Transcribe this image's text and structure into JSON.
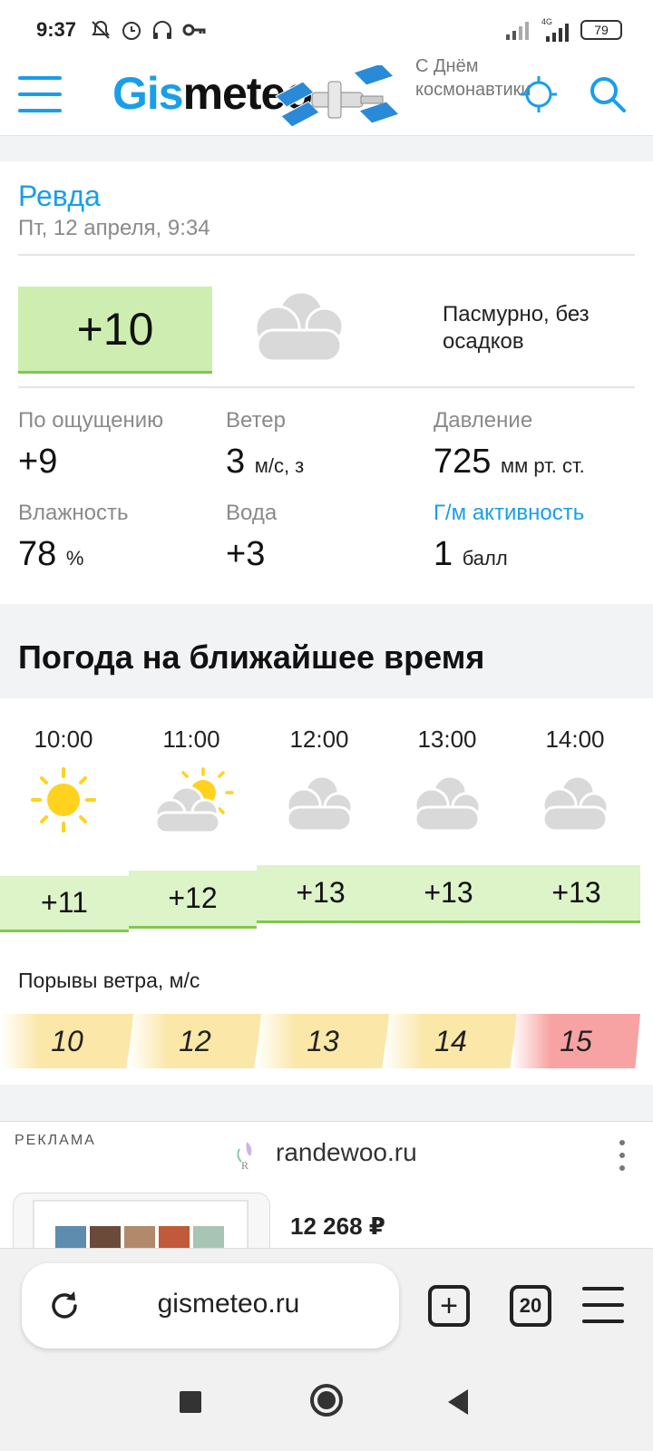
{
  "status_bar": {
    "time": "9:37",
    "battery": "79",
    "network": "4G"
  },
  "header": {
    "logo_part1": "Gis",
    "logo_part2": "meteo",
    "holiday_line1": "С Днём",
    "holiday_line2": "космонавтики"
  },
  "current": {
    "city": "Ревда",
    "date": "Пт, 12 апреля, 9:34",
    "temp": "+10",
    "icon": "cloudy-icon",
    "condition": "Пасмурно, без осадков",
    "feels_label": "По ощущению",
    "feels_value": "+9",
    "wind_label": "Ветер",
    "wind_value": "3",
    "wind_unit": "м/с, з",
    "pressure_label": "Давление",
    "pressure_value": "725",
    "pressure_unit": "мм рт. ст.",
    "humidity_label": "Влажность",
    "humidity_value": "78",
    "humidity_unit": "%",
    "water_label": "Вода",
    "water_value": "+3",
    "geomag_label": "Г/м активность",
    "geomag_value": "1",
    "geomag_unit": "балл"
  },
  "forecast": {
    "title": "Погода на ближайшее время",
    "hours": [
      {
        "time": "10:00",
        "icon": "sun-icon",
        "temp": "+11",
        "gust": "10"
      },
      {
        "time": "11:00",
        "icon": "partly-cloudy-icon",
        "temp": "+12",
        "gust": "12"
      },
      {
        "time": "12:00",
        "icon": "cloudy-icon",
        "temp": "+13",
        "gust": "13"
      },
      {
        "time": "13:00",
        "icon": "cloudy-icon",
        "temp": "+13",
        "gust": "14"
      },
      {
        "time": "14:00",
        "icon": "cloudy-icon",
        "temp": "+13",
        "gust": "15"
      }
    ],
    "gust_label": "Порывы ветра, м/с",
    "colors": {
      "temp_bar": "#ddf3c8",
      "gust_low": "#fbe7a8",
      "gust_high": "#f8a3a3"
    }
  },
  "ad": {
    "label": "РЕКЛАМА",
    "site": "randewoo.ru",
    "price": "12 268 ₽"
  },
  "browser": {
    "url": "gismeteo.ru",
    "tab_count": "20"
  },
  "colors": {
    "accent": "#1a9ee8",
    "temp_now_bg": "#cdeeb0"
  }
}
